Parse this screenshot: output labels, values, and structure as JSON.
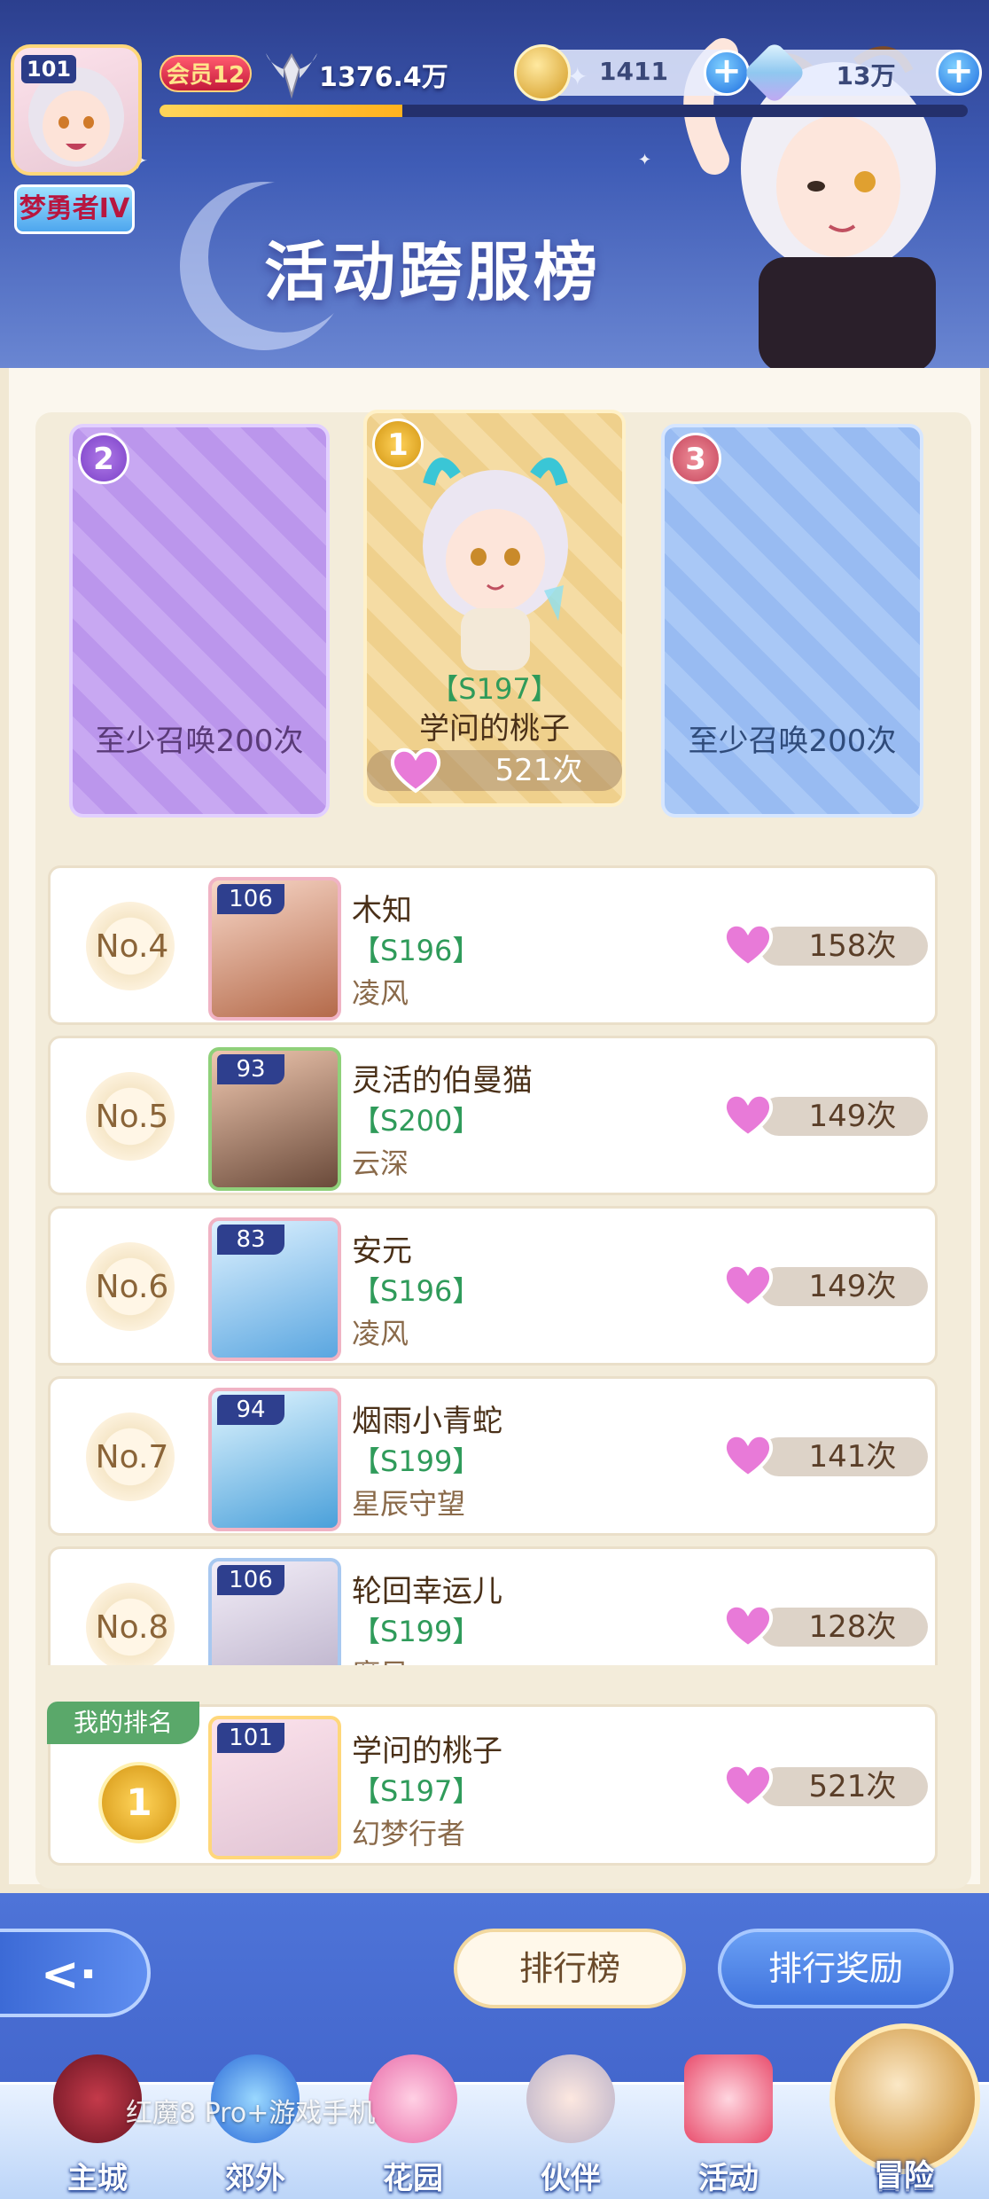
{
  "header": {
    "page_title": "活动跨服榜",
    "player": {
      "level": "101",
      "title": "梦勇者IV",
      "vip": "会员12",
      "power": "1376.4万",
      "exp_fraction": 0.3
    },
    "currencies": [
      {
        "name": "gold",
        "value": "1411"
      },
      {
        "name": "diamond",
        "value": "13万"
      }
    ]
  },
  "podium": {
    "second": {
      "rank": "2",
      "text": "至少召唤200次"
    },
    "first": {
      "rank": "1",
      "server": "【S197】",
      "name": "学问的桃子",
      "count": "521次"
    },
    "third": {
      "rank": "3",
      "text": "至少召唤200次"
    }
  },
  "list": [
    {
      "rank": "No.4",
      "level": "106",
      "name": "木知",
      "server": "【S196】",
      "guild": "凌风",
      "count": "158次"
    },
    {
      "rank": "No.5",
      "level": "93",
      "name": "灵活的伯曼猫",
      "server": "【S200】",
      "guild": "云深",
      "count": "149次"
    },
    {
      "rank": "No.6",
      "level": "83",
      "name": "安元",
      "server": "【S196】",
      "guild": "凌风",
      "count": "149次"
    },
    {
      "rank": "No.7",
      "level": "94",
      "name": "烟雨小青蛇",
      "server": "【S199】",
      "guild": "星辰守望",
      "count": "141次"
    },
    {
      "rank": "No.8",
      "level": "106",
      "name": "轮回幸运儿",
      "server": "【S199】",
      "guild": "魔风",
      "count": "128次"
    }
  ],
  "my_rank": {
    "tag": "我的排名",
    "rank": "1",
    "level": "101",
    "name": "学问的桃子",
    "server": "【S197】",
    "guild": "幻梦行者",
    "count": "521次"
  },
  "buttons": {
    "leaderboard": "排行榜",
    "rewards": "排行奖励"
  },
  "nav": [
    {
      "label": "主城"
    },
    {
      "label": "郊外"
    },
    {
      "label": "花园"
    },
    {
      "label": "伙伴"
    },
    {
      "label": "活动"
    },
    {
      "label": "冒险"
    }
  ],
  "watermark": "红魔8 Pro+游戏手机",
  "colors": {
    "header_blue": "#3f5cb6",
    "server_green": "#2f9b5a",
    "panel_bg": "#fbf7ee"
  }
}
